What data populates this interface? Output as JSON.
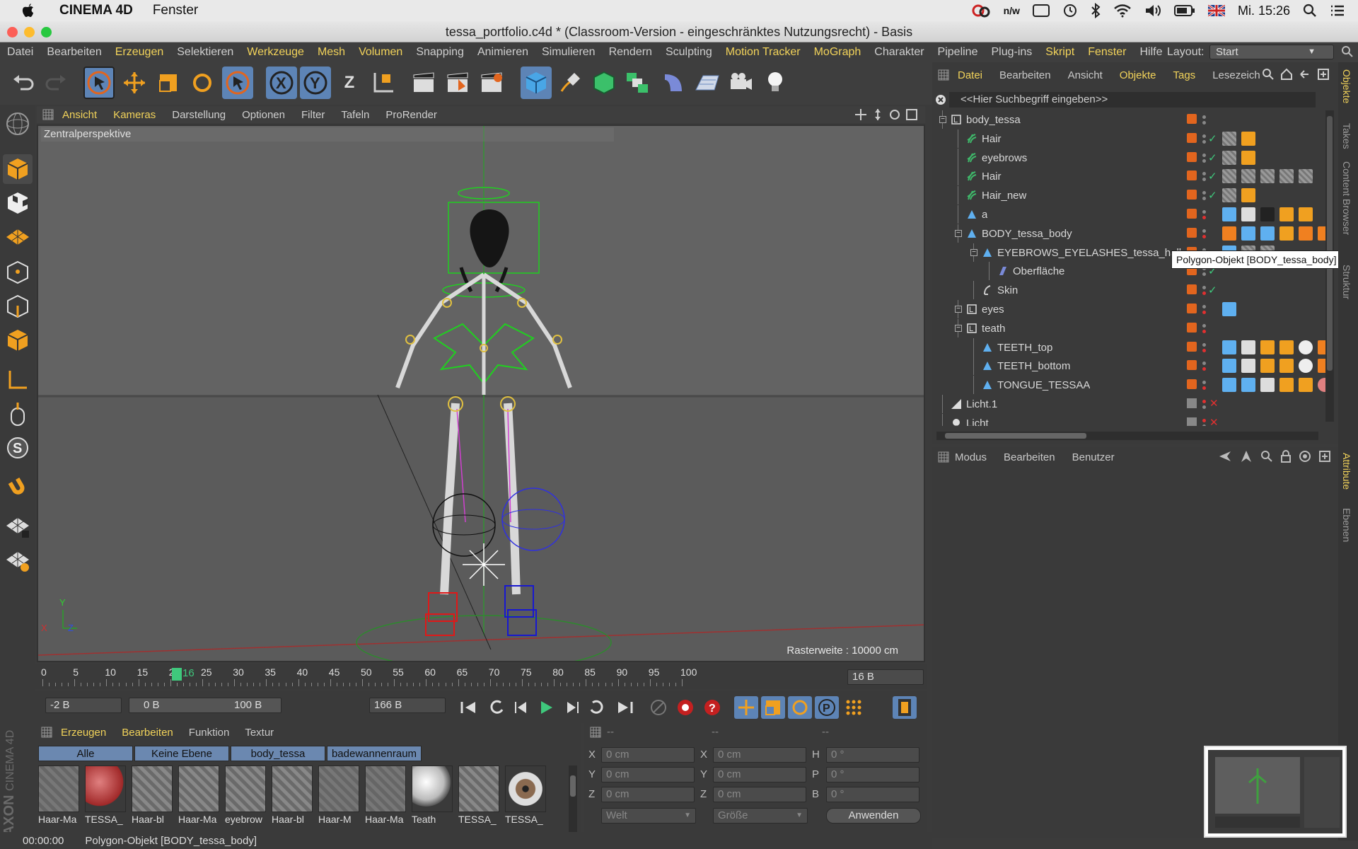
{
  "mac_menubar": {
    "app_name": "CINEMA 4D",
    "menu": "Fenster",
    "clock": "Mi. 15:26",
    "aw_icon_text": "n/w"
  },
  "window": {
    "title": "tessa_portfolio.c4d * (Classroom-Version - eingeschränktes Nutzungsrecht) - Basis"
  },
  "app_menu": {
    "items": [
      "Datei",
      "Bearbeiten",
      "Erzeugen",
      "Selektieren",
      "Werkzeuge",
      "Mesh",
      "Volumen",
      "Snapping",
      "Animieren",
      "Simulieren",
      "Rendern",
      "Sculpting",
      "Motion Tracker",
      "MoGraph",
      "Charakter",
      "Pipeline",
      "Plug-ins",
      "Skript",
      "Fenster",
      "Hilfe"
    ],
    "layout_label": "Layout:",
    "layout_value": "Start"
  },
  "toolbar": {
    "axis_x": "X",
    "axis_y": "Y",
    "axis_z": "Z"
  },
  "viewport": {
    "menu": [
      "Ansicht",
      "Kameras",
      "Darstellung",
      "Optionen",
      "Filter",
      "Tafeln",
      "ProRender"
    ],
    "label": "Zentralperspektive",
    "raster": "Rasterweite : 10000 cm",
    "axis_y": "Y",
    "axis_x": "X",
    "axis_z": "Z"
  },
  "timeline": {
    "ticks": [
      "0",
      "5",
      "10",
      "15",
      "20",
      "25",
      "30",
      "35",
      "40",
      "45",
      "50",
      "55",
      "60",
      "65",
      "70",
      "75",
      "80",
      "85",
      "90",
      "95",
      "100"
    ],
    "current": "16",
    "end_field": "16 B",
    "start_field": "-2 B",
    "range_start": "0 B",
    "range_end": "100 B",
    "max_field": "166 B"
  },
  "materials": {
    "menu": [
      "Erzeugen",
      "Bearbeiten",
      "Funktion",
      "Textur"
    ],
    "tabs": [
      "Alle",
      "Keine Ebene",
      "body_tessa",
      "badewannenraum"
    ],
    "items": [
      "Haar-Ma",
      "TESSA_",
      "Haar-bl",
      "Haar-Ma",
      "eyebrow",
      "Haar-bl",
      "Haar-M",
      "Haar-Ma",
      "Teath",
      "TESSA_",
      "TESSA_"
    ]
  },
  "coords": {
    "headers": [
      "--",
      "--",
      "--"
    ],
    "rows": [
      {
        "l1": "X",
        "v1": "0 cm",
        "l2": "X",
        "v2": "0 cm",
        "l3": "H",
        "v3": "0 °"
      },
      {
        "l1": "Y",
        "v1": "0 cm",
        "l2": "Y",
        "v2": "0 cm",
        "l3": "P",
        "v3": "0 °"
      },
      {
        "l1": "Z",
        "v1": "0 cm",
        "l2": "Z",
        "v2": "0 cm",
        "l3": "B",
        "v3": "0 °"
      }
    ],
    "mode": "Welt",
    "size": "Größe",
    "apply": "Anwenden"
  },
  "status": {
    "time": "00:00:00",
    "text": "Polygon-Objekt [BODY_tessa_body]",
    "maxon": "MAXON",
    "c4d": "CINEMA 4D"
  },
  "objects": {
    "menu": [
      "Datei",
      "Bearbeiten",
      "Ansicht",
      "Objekte",
      "Tags",
      "Lesezeich"
    ],
    "search": "<<Hier Suchbegriff eingeben>>",
    "rows": [
      {
        "name": "body_tessa",
        "indent": 0
      },
      {
        "name": "Hair",
        "indent": 1
      },
      {
        "name": "eyebrows",
        "indent": 1
      },
      {
        "name": "Hair",
        "indent": 1
      },
      {
        "name": "Hair_new",
        "indent": 1
      },
      {
        "name": "a",
        "indent": 1
      },
      {
        "name": "BODY_tessa_body",
        "indent": 1
      },
      {
        "name": "EYEBROWS_EYELASHES_tessa_halls",
        "indent": 2
      },
      {
        "name": "Oberfläche",
        "indent": 3
      },
      {
        "name": "Skin",
        "indent": 2
      },
      {
        "name": "eyes",
        "indent": 1
      },
      {
        "name": "teath",
        "indent": 1
      },
      {
        "name": "TEETH_top",
        "indent": 2
      },
      {
        "name": "TEETH_bottom",
        "indent": 2
      },
      {
        "name": "TONGUE_TESSAA",
        "indent": 2
      },
      {
        "name": "Licht.1",
        "indent": 0
      },
      {
        "name": "Licht",
        "indent": 0
      }
    ],
    "tooltip": "Polygon-Objekt [BODY_tessa_body]"
  },
  "attributes": {
    "menu": [
      "Modus",
      "Bearbeiten",
      "Benutzer"
    ]
  },
  "side_tabs": [
    "Objekte",
    "Takes",
    "Content Browser",
    "Struktur",
    "Attribute",
    "Ebenen"
  ],
  "colors": {
    "accent": "#f2d35a",
    "orange": "#e2651e",
    "panel": "#3a3a3a",
    "viewport": "#5e5e5e"
  }
}
